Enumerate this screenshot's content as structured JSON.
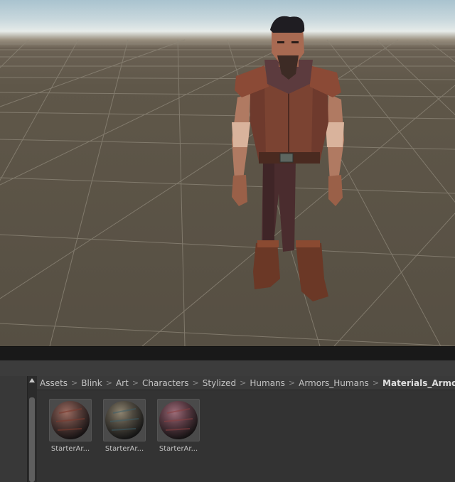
{
  "scene": {
    "sky_color": "#c9d8dd",
    "ground_color": "#5b5347",
    "grid_line_color": "#8a8376"
  },
  "project": {
    "breadcrumb": [
      "Assets",
      "Blink",
      "Art",
      "Characters",
      "Stylized",
      "Humans",
      "Armors_Humans",
      "Materials_ArmorsHum"
    ],
    "separator_icon": "chevron-right-icon",
    "assets": [
      {
        "label": "StarterAr...",
        "icon": "material-sphere-icon",
        "tint": "#5a3f3a"
      },
      {
        "label": "StarterAr...",
        "icon": "material-sphere-icon",
        "tint": "#4f4a40"
      },
      {
        "label": "StarterAr...",
        "icon": "material-sphere-icon",
        "tint": "#5c3c45"
      }
    ]
  }
}
